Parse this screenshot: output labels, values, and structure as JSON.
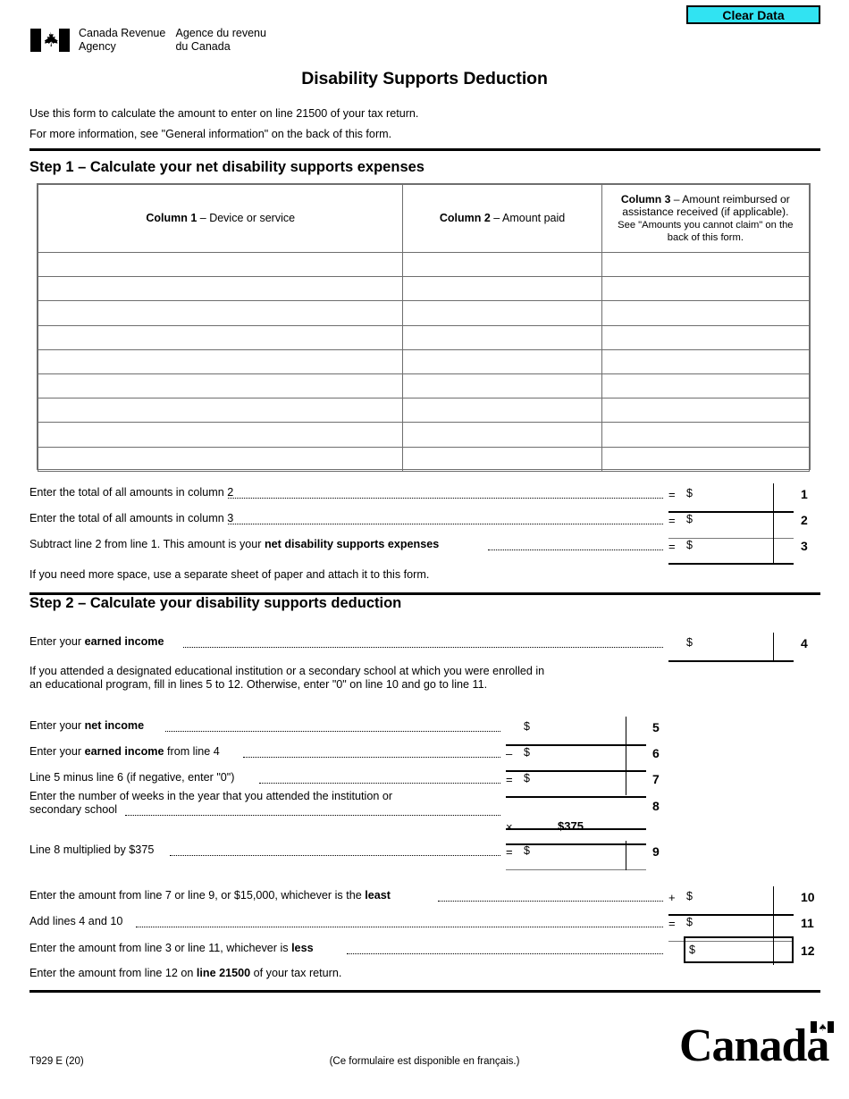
{
  "header": {
    "clear_data_label": "Clear Data",
    "agency_en_line1": "Canada Revenue",
    "agency_en_line2": "Agency",
    "agency_fr_line1": "Agence du revenu",
    "agency_fr_line2": "du Canada",
    "logo_icon": "canada-flag-icon"
  },
  "title": "Disability Supports Deduction",
  "intro": {
    "line1": "Use this form to calculate the amount to enter on line 21500 of your tax return.",
    "line2": "For more information, see \"General information\" on the back of this form."
  },
  "step1": {
    "heading": "Step 1 – Calculate your net disability supports expenses",
    "table": {
      "col1_bold": "Column 1",
      "col1_rest": " – Device or service",
      "col2_bold": "Column 2",
      "col2_rest": " – Amount paid",
      "col3_bold": "Column 3",
      "col3_rest": " – Amount reimbursed or assistance received (if applicable).",
      "col3_note": "See \"Amounts you cannot claim\" on the back of this form.",
      "row_count": 9,
      "rows": [
        {
          "device": "",
          "amount_paid": "",
          "reimbursed": ""
        },
        {
          "device": "",
          "amount_paid": "",
          "reimbursed": ""
        },
        {
          "device": "",
          "amount_paid": "",
          "reimbursed": ""
        },
        {
          "device": "",
          "amount_paid": "",
          "reimbursed": ""
        },
        {
          "device": "",
          "amount_paid": "",
          "reimbursed": ""
        },
        {
          "device": "",
          "amount_paid": "",
          "reimbursed": ""
        },
        {
          "device": "",
          "amount_paid": "",
          "reimbursed": ""
        },
        {
          "device": "",
          "amount_paid": "",
          "reimbursed": ""
        },
        {
          "device": "",
          "amount_paid": "",
          "reimbursed": ""
        }
      ]
    },
    "line1": {
      "text": "Enter the total of all amounts in column 2",
      "operator": "=",
      "currency": "$",
      "value": "",
      "number": "1"
    },
    "line2": {
      "text": "Enter the total of all amounts in column 3",
      "operator": "=",
      "currency": "$",
      "value": "",
      "number": "2"
    },
    "line3": {
      "text_pre": "Subtract line 2 from line 1. This amount is your ",
      "text_bold": "net disability supports expenses",
      "operator": "=",
      "currency": "$",
      "value": "",
      "number": "3"
    },
    "note": "If you need more space, use a separate sheet of paper and attach it to this form."
  },
  "step2": {
    "heading": "Step 2 – Calculate your disability supports deduction",
    "line4": {
      "text_pre": "Enter your ",
      "text_bold": "earned income",
      "operator": "",
      "currency": "$",
      "value": "",
      "number": "4"
    },
    "note_line1": "If you attended a designated educational institution or a secondary school at which you were enrolled in",
    "note_line2": "an educational program, fill in lines 5 to 12. Otherwise, enter \"0\" on line 10 and go to line 11.",
    "line5": {
      "text_pre": "Enter your ",
      "text_bold": "net income",
      "text_post": "",
      "operator": "",
      "currency": "$",
      "value": "",
      "number": "5"
    },
    "line6": {
      "text_pre": "Enter your ",
      "text_bold": "earned income",
      "text_post": " from line 4",
      "operator": "–",
      "currency": "$",
      "value": "",
      "number": "6"
    },
    "line7": {
      "text": "Line 5 minus line 6 (if negative, enter \"0\")",
      "operator": "=",
      "currency": "$",
      "value": "",
      "number": "7"
    },
    "line8": {
      "text_a": "Enter the number of weeks in the year that you attended the institution or",
      "text_b": "secondary school",
      "operator": "",
      "currency": "",
      "value": "",
      "number": "8"
    },
    "multiplier_row": {
      "operator": "×",
      "factor": "$375"
    },
    "line9": {
      "text": "Line 8 multiplied by $375",
      "operator": "=",
      "currency": "$",
      "value": "",
      "number": "9"
    },
    "line10": {
      "text_pre": "Enter the amount from line 7 or line 9, or $15,000, whichever is the ",
      "text_bold": "least",
      "operator": "+",
      "currency": "$",
      "value": "",
      "number": "10"
    },
    "line11": {
      "text": "Add lines 4 and 10",
      "operator": "=",
      "currency": "$",
      "value": "",
      "number": "11"
    },
    "line12": {
      "text_pre": "Enter the amount from line 3 or line 11, whichever is ",
      "text_bold": "less",
      "operator": "",
      "currency": "$",
      "value": "",
      "number": "12"
    },
    "closing_pre": "Enter the amount from line 12 on ",
    "closing_bold": "line 21500",
    "closing_post": " of your tax return."
  },
  "footer": {
    "form_code": "T929 E (20)",
    "french_note": "(Ce formulaire est disponible en français.)",
    "wordmark": "Canada",
    "wordmark_flag_icon": "canada-flag-icon"
  },
  "colors": {
    "clear_data_bg": "#31E3F2",
    "rule": "#000000",
    "table_border": "#6e6e6e"
  }
}
